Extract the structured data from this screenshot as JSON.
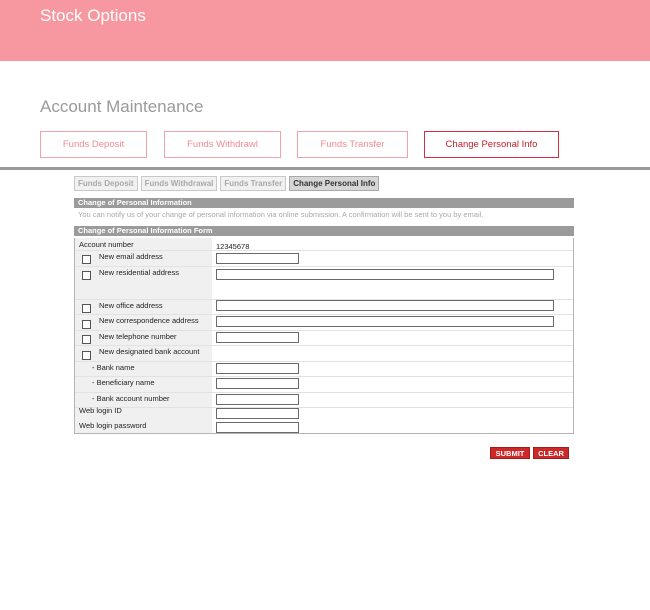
{
  "banner": {
    "title": "Stock Options"
  },
  "section": {
    "title": "Account Maintenance"
  },
  "main_tabs": [
    {
      "label": "Funds Deposit"
    },
    {
      "label": "Funds Withdrawl"
    },
    {
      "label": "Funds Transfer"
    },
    {
      "label": "Change Personal Info"
    }
  ],
  "sub_tabs": [
    {
      "label": "Funds Deposit"
    },
    {
      "label": "Funds Withdrawal"
    },
    {
      "label": "Funds Transfer"
    },
    {
      "label": "Change Personal Info"
    }
  ],
  "info": {
    "header": "Change of Personal Information",
    "text": "You can notify us of your change of personal information via online submission. A confirmation will be sent to you by email."
  },
  "form": {
    "header": "Change of Personal Information Form",
    "account_label": "Account number",
    "account_value": "12345678",
    "fields": {
      "email": "New email address",
      "residential": "New residential address",
      "office": "New office address",
      "correspondence": "New correspondence address",
      "telephone": "New telephone number",
      "bank_account": "New designated bank account",
      "bank_name": "- Bank name",
      "beneficiary": "- Beneficiary name",
      "bank_number": "- Bank account number",
      "login_id": "Web login ID",
      "login_password": "Web login password"
    }
  },
  "buttons": {
    "submit": "SUBMIT",
    "clear": "CLEAR"
  }
}
